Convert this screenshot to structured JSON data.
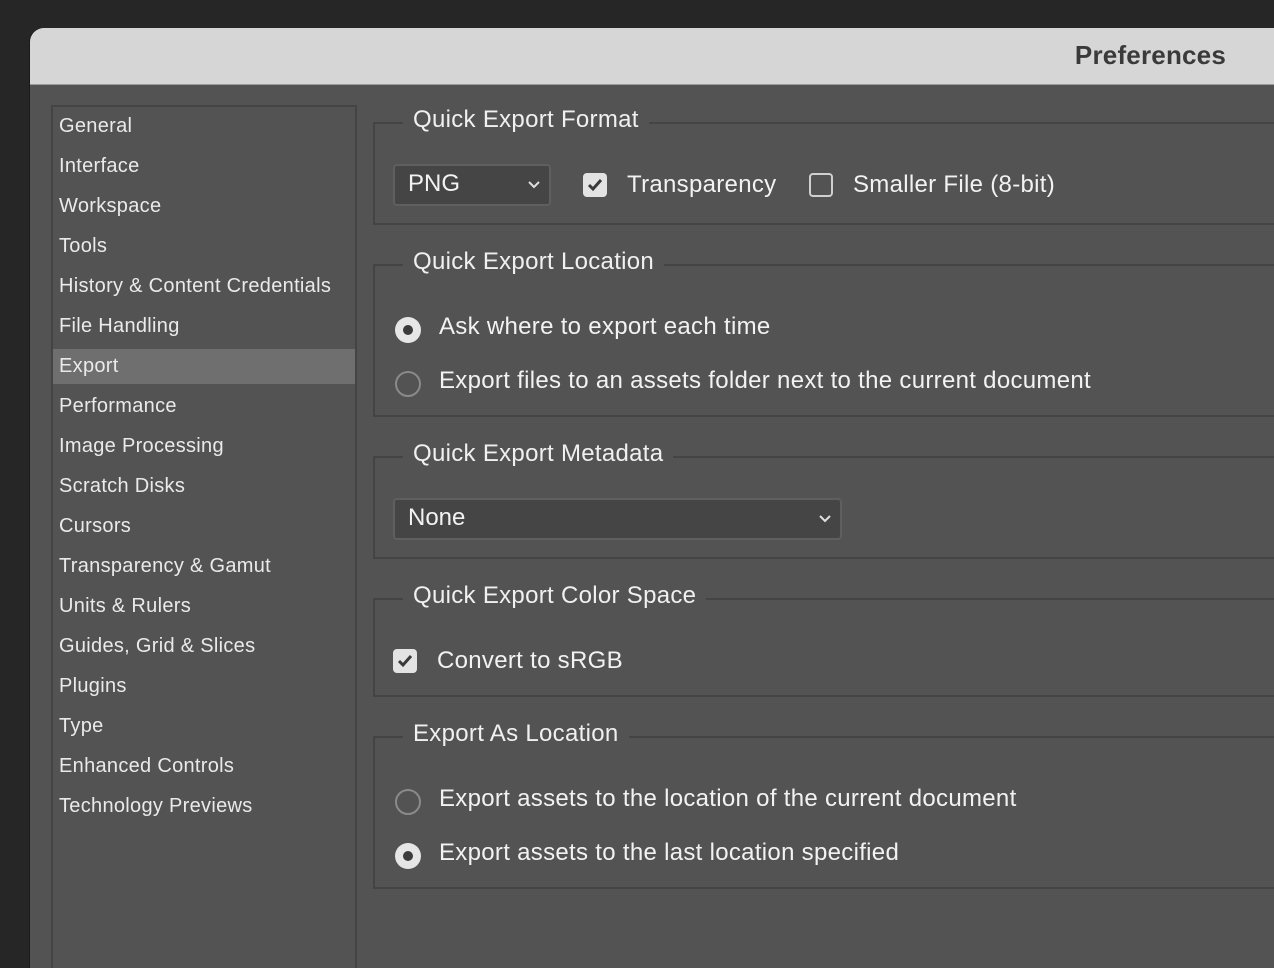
{
  "window": {
    "title": "Preferences"
  },
  "sidebar": {
    "items": [
      {
        "label": "General"
      },
      {
        "label": "Interface"
      },
      {
        "label": "Workspace"
      },
      {
        "label": "Tools"
      },
      {
        "label": "History & Content Credentials"
      },
      {
        "label": "File Handling"
      },
      {
        "label": "Export",
        "selected": true
      },
      {
        "label": "Performance"
      },
      {
        "label": "Image Processing"
      },
      {
        "label": "Scratch Disks"
      },
      {
        "label": "Cursors"
      },
      {
        "label": "Transparency & Gamut"
      },
      {
        "label": "Units & Rulers"
      },
      {
        "label": "Guides, Grid & Slices"
      },
      {
        "label": "Plugins"
      },
      {
        "label": "Type"
      },
      {
        "label": "Enhanced Controls"
      },
      {
        "label": "Technology Previews"
      }
    ]
  },
  "quick_export_format": {
    "title": "Quick Export Format",
    "format_value": "PNG",
    "transparency_label": "Transparency",
    "transparency_checked": true,
    "smaller_file_label": "Smaller File (8-bit)",
    "smaller_file_checked": false
  },
  "quick_export_location": {
    "title": "Quick Export Location",
    "options": [
      {
        "label": "Ask where to export each time",
        "selected": true
      },
      {
        "label": "Export files to an assets folder next to the current document",
        "selected": false
      }
    ]
  },
  "quick_export_metadata": {
    "title": "Quick Export Metadata",
    "value": "None"
  },
  "quick_export_color_space": {
    "title": "Quick Export Color Space",
    "convert_label": "Convert to sRGB",
    "convert_checked": true
  },
  "export_as_location": {
    "title": "Export As Location",
    "options": [
      {
        "label": "Export assets to the location of the current document",
        "selected": false
      },
      {
        "label": "Export assets to the last location specified",
        "selected": true
      }
    ]
  }
}
